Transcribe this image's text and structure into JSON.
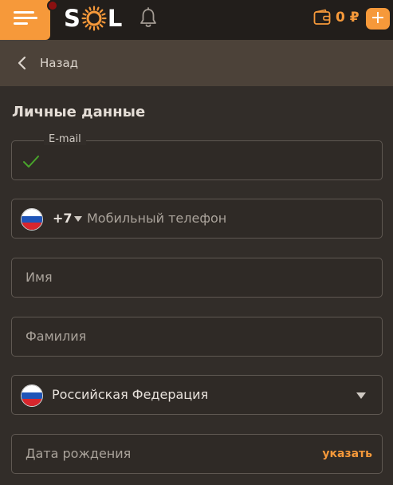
{
  "header": {
    "logo_text_left": "S",
    "logo_text_right": "L",
    "balance": "0 ₽",
    "icons": [
      "menu-icon",
      "bell-icon",
      "wallet-icon",
      "plus-icon"
    ],
    "accent_color": "#f6993a",
    "add_label": "+"
  },
  "nav": {
    "back_label": "Назад"
  },
  "form": {
    "title": "Личные данные",
    "email": {
      "legend": "E-mail",
      "value": ""
    },
    "phone": {
      "code": "+7",
      "placeholder": "Мобильный телефон",
      "flag": "ru"
    },
    "first_name": {
      "placeholder": "Имя"
    },
    "last_name": {
      "placeholder": "Фамилия"
    },
    "country": {
      "value": "Российская Федерация",
      "flag": "ru"
    },
    "birthdate": {
      "placeholder": "Дата рождения",
      "action": "указать"
    }
  }
}
